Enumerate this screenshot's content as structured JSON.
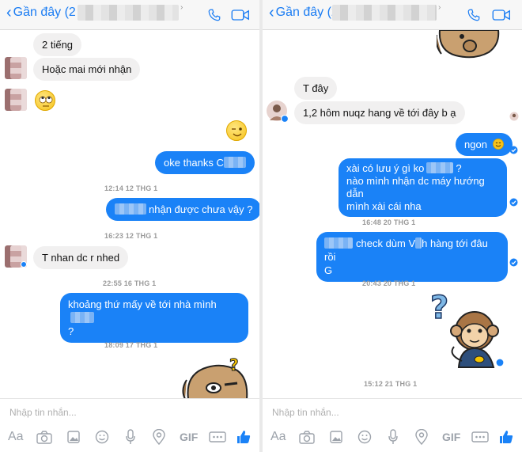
{
  "left": {
    "header": {
      "back_label": "Gần đây (2"
    },
    "messages": {
      "m1": "2 tiếng",
      "m2": "Hoặc mai mới nhận",
      "m3": "oke thanks C",
      "ts1": "12:14 12 THG 1",
      "m4": "nhận được chưa vậy ?",
      "ts2": "16:23 12 THG 1",
      "m5": "T nhan dc r nhed",
      "ts3": "22:55 16 THG 1",
      "m6a": "khoảng thứ mấy về tới nhà mình",
      "m6b": "?",
      "ts4": "18:09 17 THG 1"
    },
    "composer": {
      "placeholder": "Nhập tin nhắn..."
    }
  },
  "right": {
    "header": {
      "back_label": "Gần đây (2"
    },
    "messages": {
      "m1": "T đây",
      "m2": "1,2 hôm nuqz hang về tới đây b ạ",
      "m3": "ngon",
      "m4a": "xài có lưu ý gì ko",
      "m4a_tail": "?",
      "m4b": "nào mình nhận dc máy hướng dẫn",
      "m4c": "mình xài cái nha",
      "ts1": "16:48 20 THG 1",
      "m5a": "check dùm V",
      "m5b": "h hàng tới đâu rồi",
      "m5c": "G",
      "ts2": "20:43 20 THG 1",
      "ts3": "15:12 21 THG 1"
    },
    "composer": {
      "placeholder": "Nhập tin nhắn..."
    }
  },
  "toolbar": {
    "aa": "Aa",
    "gif": "GIF"
  },
  "colors": {
    "accent": "#1a82f7",
    "incoming": "#f1f0f0",
    "timestamp": "#9a9a9a"
  },
  "icons": [
    "phone-icon",
    "video-icon",
    "camera-icon",
    "gallery-icon",
    "smiley-icon",
    "microphone-icon",
    "location-icon",
    "more-icon",
    "like-icon"
  ]
}
